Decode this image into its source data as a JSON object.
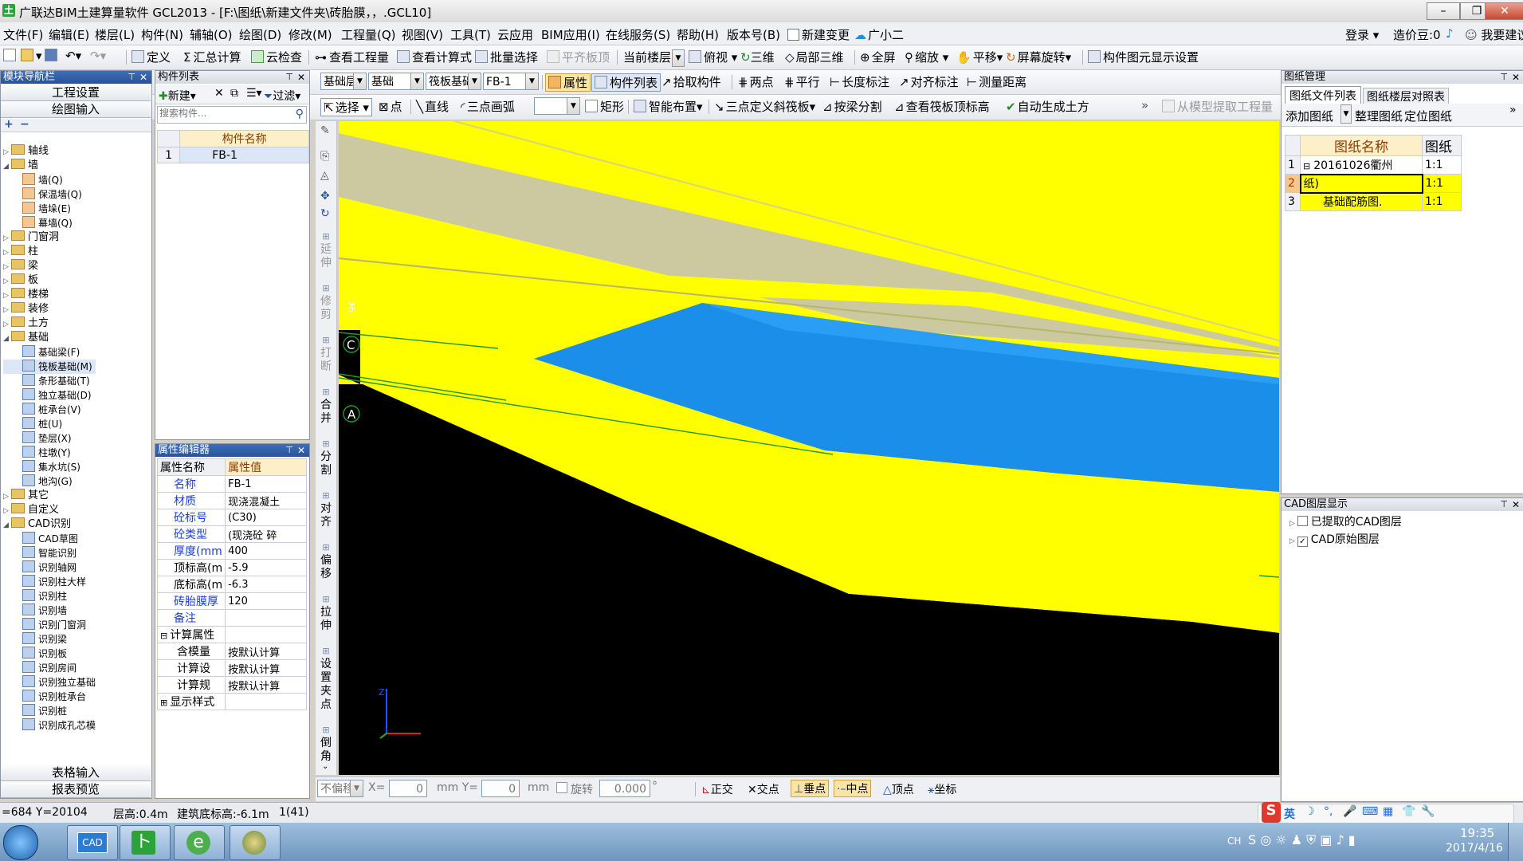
{
  "window": {
    "title": "广联达BIM土建算量软件 GCL2013 - [F:\\图纸\\新建文件夹\\砖胎膜，，.GCL10]",
    "app_icon": "土"
  },
  "menubar": [
    "文件(F)",
    "编辑(E)",
    "楼层(L)",
    "构件(N)",
    "辅轴(O)",
    "绘图(D)",
    "修改(M)",
    "工程量(Q)",
    "视图(V)",
    "工具(T)",
    "云应用",
    "BIM应用(I)",
    "在线服务(S)",
    "帮助(H)",
    "版本号(B)",
    "新建变更",
    "广小二"
  ],
  "menubar_right": {
    "login": "登录",
    "coins": "造价豆:0",
    "suggest": "我要建议"
  },
  "toolbar1": [
    "定义",
    "汇总计算",
    "云检查",
    "查看工程量",
    "查看计算式",
    "批量选择",
    "平齐板顶",
    "当前楼层",
    "俯视",
    "三维",
    "局部三维",
    "全屏",
    "缩放",
    "平移",
    "屏幕旋转",
    "构件图元显示设置"
  ],
  "toolbar2": {
    "floor_combo": "基础层",
    "type_combo": "基础",
    "sub_combo": "筏板基础",
    "comp_combo": "FB-1",
    "buttons": [
      "属性",
      "构件列表",
      "拾取构件",
      "两点",
      "平行",
      "长度标注",
      "对齐标注",
      "测量距离"
    ]
  },
  "toolbar3": [
    "选择",
    "点",
    "直线",
    "三点画弧",
    "矩形",
    "智能布置",
    "三点定义斜筏板",
    "按梁分割",
    "查看筏板顶标高",
    "自动生成土方"
  ],
  "toolbar3_right": "从模型提取工程量",
  "left_nav": {
    "title": "模块导航栏",
    "top_buttons": [
      "工程设置",
      "绘图输入"
    ],
    "tree": [
      {
        "label": "轴线",
        "level": 0,
        "expand": "▷",
        "type": "folder"
      },
      {
        "label": "墙",
        "level": 0,
        "expand": "◢",
        "type": "folder"
      },
      {
        "label": "墙(Q)",
        "level": 1,
        "type": "item"
      },
      {
        "label": "保温墙(Q)",
        "level": 1,
        "type": "item"
      },
      {
        "label": "墙垛(E)",
        "level": 1,
        "type": "item"
      },
      {
        "label": "幕墙(Q)",
        "level": 1,
        "type": "item"
      },
      {
        "label": "门窗洞",
        "level": 0,
        "expand": "▷",
        "type": "folder"
      },
      {
        "label": "柱",
        "level": 0,
        "expand": "▷",
        "type": "folder"
      },
      {
        "label": "梁",
        "level": 0,
        "expand": "▷",
        "type": "folder"
      },
      {
        "label": "板",
        "level": 0,
        "expand": "▷",
        "type": "folder"
      },
      {
        "label": "楼梯",
        "level": 0,
        "expand": "▷",
        "type": "folder"
      },
      {
        "label": "装修",
        "level": 0,
        "expand": "▷",
        "type": "folder"
      },
      {
        "label": "土方",
        "level": 0,
        "expand": "▷",
        "type": "folder"
      },
      {
        "label": "基础",
        "level": 0,
        "expand": "◢",
        "type": "folder"
      },
      {
        "label": "基础梁(F)",
        "level": 1,
        "type": "item"
      },
      {
        "label": "筏板基础(M)",
        "level": 1,
        "type": "item",
        "selected": true
      },
      {
        "label": "条形基础(T)",
        "level": 1,
        "type": "item"
      },
      {
        "label": "独立基础(D)",
        "level": 1,
        "type": "item"
      },
      {
        "label": "桩承台(V)",
        "level": 1,
        "type": "item"
      },
      {
        "label": "桩(U)",
        "level": 1,
        "type": "item"
      },
      {
        "label": "垫层(X)",
        "level": 1,
        "type": "item"
      },
      {
        "label": "柱墩(Y)",
        "level": 1,
        "type": "item"
      },
      {
        "label": "集水坑(S)",
        "level": 1,
        "type": "item"
      },
      {
        "label": "地沟(G)",
        "level": 1,
        "type": "item"
      },
      {
        "label": "其它",
        "level": 0,
        "expand": "▷",
        "type": "folder"
      },
      {
        "label": "自定义",
        "level": 0,
        "expand": "▷",
        "type": "folder"
      },
      {
        "label": "CAD识别",
        "level": 0,
        "expand": "◢",
        "type": "folder"
      },
      {
        "label": "CAD草图",
        "level": 1,
        "type": "item"
      },
      {
        "label": "智能识别",
        "level": 1,
        "type": "item"
      },
      {
        "label": "识别轴网",
        "level": 1,
        "type": "item"
      },
      {
        "label": "识别柱大样",
        "level": 1,
        "type": "item"
      },
      {
        "label": "识别柱",
        "level": 1,
        "type": "item"
      },
      {
        "label": "识别墙",
        "level": 1,
        "type": "item"
      },
      {
        "label": "识别门窗洞",
        "level": 1,
        "type": "item"
      },
      {
        "label": "识别梁",
        "level": 1,
        "type": "item"
      },
      {
        "label": "识别板",
        "level": 1,
        "type": "item"
      },
      {
        "label": "识别房间",
        "level": 1,
        "type": "item"
      },
      {
        "label": "识别独立基础",
        "level": 1,
        "type": "item"
      },
      {
        "label": "识别桩承台",
        "level": 1,
        "type": "item"
      },
      {
        "label": "识别桩",
        "level": 1,
        "type": "item"
      },
      {
        "label": "识别成孔芯模",
        "level": 1,
        "type": "item"
      }
    ],
    "bottom_buttons": [
      "表格输入",
      "报表预览"
    ]
  },
  "component_list": {
    "title": "构件列表",
    "new_btn": "新建",
    "filter_btn": "过滤",
    "search_placeholder": "搜索构件...",
    "header": "构件名称",
    "rows": [
      {
        "index": "1",
        "name": "FB-1"
      }
    ]
  },
  "property_editor": {
    "title": "属性编辑器",
    "col_name": "属性名称",
    "col_value": "属性值",
    "rows": [
      {
        "name": "名称",
        "value": "FB-1",
        "blue": true
      },
      {
        "name": "材质",
        "value": "现浇混凝土",
        "blue": true
      },
      {
        "name": "砼标号",
        "value": "(C30)",
        "blue": true
      },
      {
        "name": "砼类型",
        "value": "(现浇砼 碎",
        "blue": true
      },
      {
        "name": "厚度(mm",
        "value": "400",
        "blue": true
      },
      {
        "name": "顶标高(m",
        "value": "-5.9",
        "blue": false
      },
      {
        "name": "底标高(m",
        "value": "-6.3",
        "blue": false
      },
      {
        "name": "砖胎膜厚",
        "value": "120",
        "blue": true
      },
      {
        "name": "备注",
        "value": "",
        "blue": true
      },
      {
        "name": "计算属性",
        "value": "",
        "group": true,
        "expand": "⊟"
      },
      {
        "name": "含模量",
        "value": "按默认计算",
        "indent": true
      },
      {
        "name": "计算设",
        "value": "按默认计算",
        "indent": true
      },
      {
        "name": "计算规",
        "value": "按默认计算",
        "indent": true
      },
      {
        "name": "显示样式",
        "value": "",
        "group": true,
        "expand": "⊞"
      }
    ]
  },
  "vertical_tools": [
    "延伸",
    "修剪",
    "打断",
    "合并",
    "分割",
    "对齐",
    "偏移",
    "拉伸",
    "设置夹点",
    "倒角"
  ],
  "viewport": {
    "axis_labels": [
      "C",
      "A"
    ],
    "small_label": "9€"
  },
  "snap_bar": {
    "mode": "不偏移",
    "x_label": "X=",
    "x_value": "0",
    "y_label": "mm Y=",
    "y_value": "0",
    "unit": "mm",
    "rotate_label": "旋转",
    "rotate_value": "0.000",
    "snaps": [
      "正交",
      "交点",
      "垂点",
      "中点",
      "顶点",
      "坐标"
    ]
  },
  "drawing_manager": {
    "title": "图纸管理",
    "tabs": [
      "图纸文件列表",
      "图纸楼层对照表"
    ],
    "buttons": [
      "添加图纸",
      "整理图纸",
      "定位图纸"
    ],
    "header": [
      "图纸名称",
      "图纸"
    ],
    "rows": [
      {
        "index": "1",
        "name": "20161026衢州",
        "scale": "1:1",
        "expand": "⊟",
        "highlight": false
      },
      {
        "index": "2",
        "name": "纸)",
        "scale": "1:1",
        "highlight": true
      },
      {
        "index": "3",
        "name": "基础配筋图.",
        "scale": "1:1",
        "highlight": true
      }
    ]
  },
  "cad_layers": {
    "title": "CAD图层显示",
    "items": [
      {
        "label": "已提取的CAD图层",
        "checked": false
      },
      {
        "label": "CAD原始图层",
        "checked": true
      }
    ]
  },
  "statusbar": {
    "coords": "=684 Y=20104",
    "floor_height": "层高:0.4m",
    "base_elevation": "建筑底标高:-6.1m",
    "count": "1(41)"
  },
  "ime_bar": [
    "S",
    "英"
  ],
  "taskbar": {
    "apps": [
      "CAD",
      "广联达",
      "IE",
      "程序"
    ],
    "lang": "CH",
    "time": "19:35",
    "date": "2017/4/16"
  },
  "colors": {
    "yellow": "#ffff00",
    "beige": "#ccc9a0",
    "blue": "#1a8ee8",
    "gray": "#a8a8a8",
    "title_blue": "#2a5298"
  }
}
